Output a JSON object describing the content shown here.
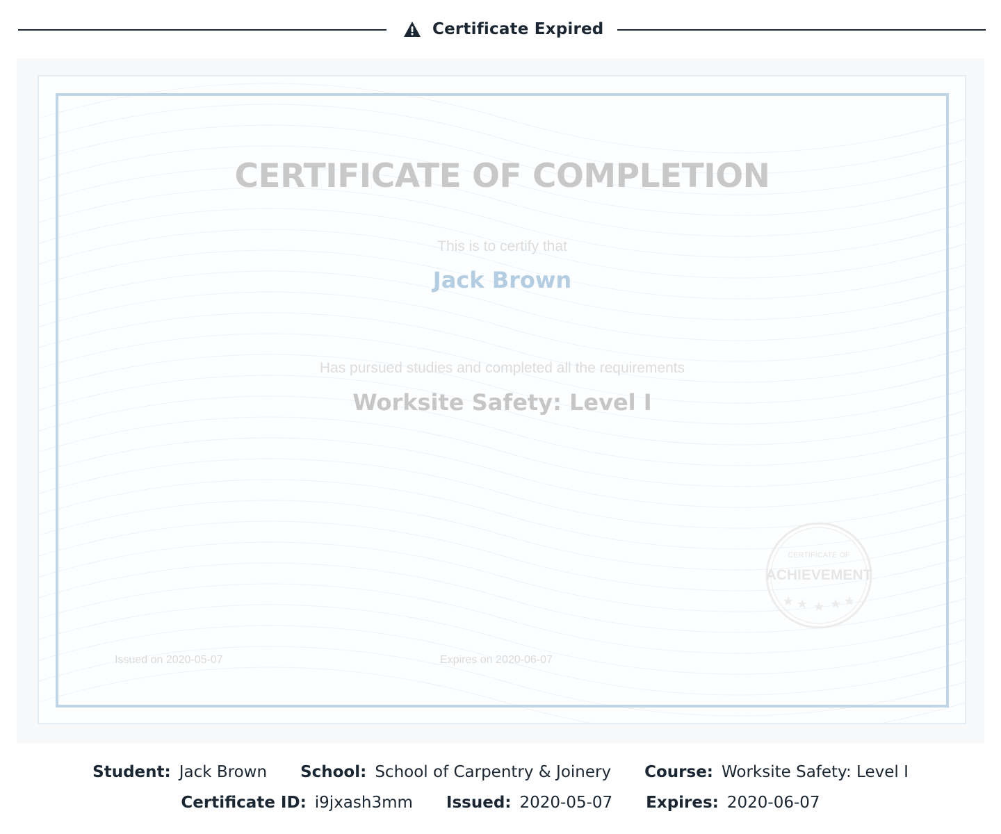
{
  "banner": {
    "icon": "warning-icon",
    "title": "Certificate Expired"
  },
  "certificate": {
    "title": "CERTIFICATE OF COMPLETION",
    "certify_text": "This is to certify that",
    "recipient_name": "Jack Brown",
    "pursued_text": "Has pursued studies and completed all the requirements",
    "course": "Worksite Safety: Level I",
    "issued_text": "Issued on 2020-05-07",
    "expires_text": "Expires on 2020-06-07",
    "seal": {
      "top_text": "CERTIFICATE OF",
      "main_text": "ACHIEVEMENT"
    },
    "colors": {
      "frame": "#bfd6e8",
      "name": "#b3cde3",
      "title": "#c8c8c8"
    }
  },
  "details": {
    "row1": [
      {
        "label": "Student:",
        "value": "Jack Brown"
      },
      {
        "label": "School:",
        "value": "School of Carpentry & Joinery"
      },
      {
        "label": "Course:",
        "value": "Worksite Safety: Level I"
      }
    ],
    "row2": [
      {
        "label": "Certificate ID:",
        "value": "i9jxash3mm"
      },
      {
        "label": "Issued:",
        "value": "2020-05-07"
      },
      {
        "label": "Expires:",
        "value": "2020-06-07"
      }
    ]
  }
}
